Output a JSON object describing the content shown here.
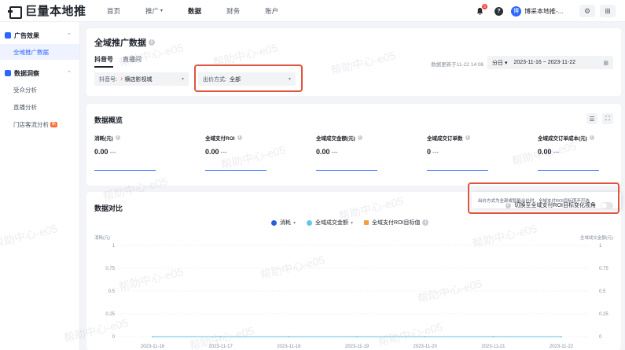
{
  "nav": {
    "logo_text": "巨量本地推",
    "items": [
      {
        "label": "首页",
        "active": false,
        "caret": false
      },
      {
        "label": "推广",
        "active": false,
        "caret": true
      },
      {
        "label": "数据",
        "active": true,
        "caret": false
      },
      {
        "label": "财务",
        "active": false,
        "caret": false
      },
      {
        "label": "账户",
        "active": false,
        "caret": false
      }
    ],
    "bell_badge": "5",
    "help_label": "?",
    "avatar_initial": "博",
    "user_name": "博采本地推-...",
    "gear_icon": "gear-icon",
    "grid_icon": "grid-icon"
  },
  "sidebar": {
    "groups": [
      {
        "label": "广告效果",
        "icon_color": "#2b66ff",
        "items": [
          {
            "label": "全域推广数据",
            "active": true,
            "hot": ""
          }
        ]
      },
      {
        "label": "数据洞察",
        "icon_color": "#2b66ff",
        "items": [
          {
            "label": "受众分析",
            "active": false,
            "hot": ""
          },
          {
            "label": "直播分析",
            "active": false,
            "hot": ""
          },
          {
            "label": "门店客流分析",
            "active": false,
            "hot": "新"
          }
        ]
      }
    ]
  },
  "header": {
    "title": "全域推广数据",
    "tabs": [
      {
        "label": "抖音号",
        "active": true
      },
      {
        "label": "直播间",
        "active": false
      }
    ],
    "account_filter": {
      "label": "抖音号:",
      "value": "横店影视城"
    },
    "bid_filter": {
      "label": "出价方式:",
      "value": "全部"
    },
    "update_text": "数据更新于11-22 14:06",
    "granularity": "分日",
    "date_range": "2023-11-16 ~ 2023-11-22"
  },
  "overview": {
    "title": "数据概览",
    "metrics": [
      {
        "label": "消耗(元)",
        "value": "0.00",
        "delta": "---"
      },
      {
        "label": "全域支付ROI",
        "value": "0.00",
        "delta": "---"
      },
      {
        "label": "全域成交金额(元)",
        "value": "0.00",
        "delta": "---"
      },
      {
        "label": "全域成交订单数",
        "value": "0",
        "delta": "---"
      },
      {
        "label": "全域成交订单成本(元)",
        "value": "0.00",
        "delta": "---"
      }
    ]
  },
  "compare": {
    "title": "数据对比",
    "tooltip": "出价方式为全部或智能出价时，全域支付ROI目标值不可选",
    "switch_label": "切换至全域支付ROI目标变化视角",
    "legend": [
      {
        "label": "消耗",
        "color": "#2b5fd9",
        "shape": "dot",
        "caret": true
      },
      {
        "label": "全域成交金额",
        "color": "#5ec8e6",
        "shape": "dot",
        "caret": true
      },
      {
        "label": "全域支付ROI目标值",
        "color": "#f0a040",
        "shape": "square",
        "caret": false
      }
    ]
  },
  "chart_data": {
    "type": "line",
    "x": [
      "2023-11-16",
      "2023-11-17",
      "2023-11-18",
      "2023-11-19",
      "2023-11-20",
      "2023-11-21",
      "2023-11-22"
    ],
    "series": [
      {
        "name": "消耗",
        "values": [
          0,
          0,
          0,
          0,
          0,
          0,
          0
        ],
        "color": "#2b5fd9"
      },
      {
        "name": "全域成交金额",
        "values": [
          0,
          0,
          0,
          0,
          0,
          0,
          0
        ],
        "color": "#5ec8e6"
      }
    ],
    "ylabel_left": "消耗(元)",
    "ylabel_right": "全域成交金额(元)",
    "y_ticks": [
      "0",
      "0.25",
      "0.5",
      "0.75",
      "1"
    ],
    "ylim": [
      0,
      1
    ],
    "grid": true
  },
  "watermark": {
    "text": "帮助中心-e05"
  }
}
